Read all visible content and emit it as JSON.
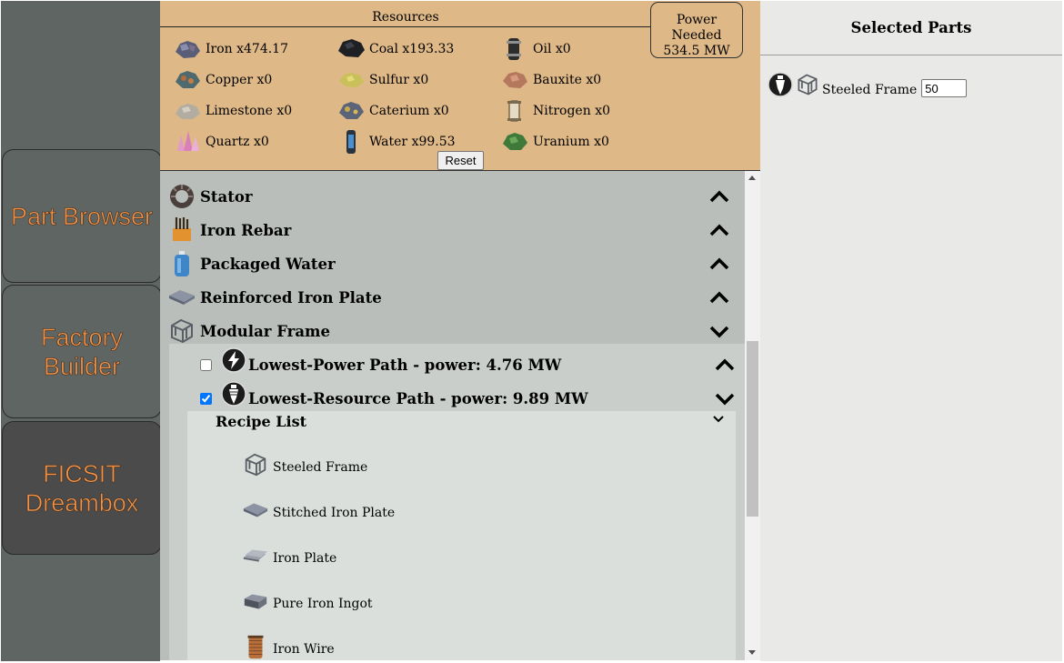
{
  "nav": {
    "part_browser": "Part Browser",
    "factory_builder_line1": "Factory",
    "factory_builder_line2": "Builder",
    "ficsit_line1": "FICSIT",
    "ficsit_line2": "Dreambox"
  },
  "resources": {
    "title": "Resources",
    "items": [
      {
        "label": "Iron x474.17",
        "icon": "iron-ore-icon"
      },
      {
        "label": "Coal x193.33",
        "icon": "coal-icon"
      },
      {
        "label": "Oil x0",
        "icon": "oil-icon"
      },
      {
        "label": "Copper x0",
        "icon": "copper-ore-icon"
      },
      {
        "label": "Sulfur x0",
        "icon": "sulfur-icon"
      },
      {
        "label": "Bauxite x0",
        "icon": "bauxite-icon"
      },
      {
        "label": "Limestone x0",
        "icon": "limestone-icon"
      },
      {
        "label": "Caterium x0",
        "icon": "caterium-ore-icon"
      },
      {
        "label": "Nitrogen x0",
        "icon": "nitrogen-icon"
      },
      {
        "label": "Quartz x0",
        "icon": "quartz-icon"
      },
      {
        "label": "Water x99.53",
        "icon": "water-icon"
      },
      {
        "label": "Uranium x0",
        "icon": "uranium-icon"
      }
    ],
    "power_label": "Power Needed",
    "power_value": "534.5 MW",
    "reset_label": "Reset"
  },
  "parts": [
    {
      "name": "Stator",
      "icon": "stator-icon",
      "expanded": false
    },
    {
      "name": "Iron Rebar",
      "icon": "iron-rebar-icon",
      "expanded": false
    },
    {
      "name": "Packaged Water",
      "icon": "packaged-water-icon",
      "expanded": false
    },
    {
      "name": "Reinforced Iron Plate",
      "icon": "reinforced-iron-plate-icon",
      "expanded": false
    },
    {
      "name": "Modular Frame",
      "icon": "modular-frame-icon",
      "expanded": true
    }
  ],
  "paths": [
    {
      "label": "Lowest-Power Path - power: 4.76 MW",
      "checked": false,
      "icon": "lightning-icon"
    },
    {
      "label": "Lowest-Resource Path - power: 9.89 MW",
      "checked": true,
      "icon": "drill-icon"
    }
  ],
  "recipe_list": {
    "title": "Recipe List",
    "items": [
      {
        "label": "Steeled Frame",
        "icon": "modular-frame-icon"
      },
      {
        "label": "Stitched Iron Plate",
        "icon": "reinforced-iron-plate-icon"
      },
      {
        "label": "Iron Plate",
        "icon": "iron-plate-icon"
      },
      {
        "label": "Pure Iron Ingot",
        "icon": "iron-ingot-icon"
      },
      {
        "label": "Iron Wire",
        "icon": "iron-wire-icon"
      }
    ]
  },
  "selected": {
    "title": "Selected Parts",
    "item_label": "Steeled Frame",
    "item_qty": "50"
  },
  "colors": {
    "nav_bg": "#5f6563",
    "nav_text": "#f0924a",
    "resources_bg": "#deb887",
    "list_bg": "#b9bebb",
    "selected_bg": "#e9eae8"
  }
}
